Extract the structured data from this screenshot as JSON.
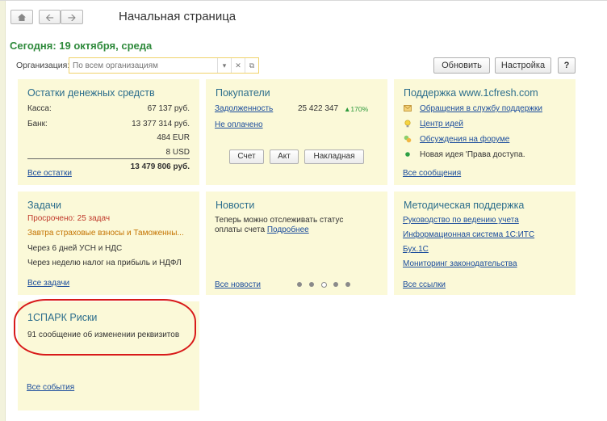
{
  "header": {
    "title": "Начальная страница",
    "home_icon": "home-icon",
    "back_icon": "arrow-left-icon",
    "forward_icon": "arrow-right-icon"
  },
  "today": "Сегодня: 19 октября, среда",
  "organization": {
    "label": "Организация:",
    "placeholder": "По всем организациям"
  },
  "toolbar": {
    "refresh": "Обновить",
    "settings": "Настройка",
    "help": "?"
  },
  "cash": {
    "title": "Остатки денежных средств",
    "rows": [
      {
        "label": "Касса:",
        "value": "67 137 руб."
      },
      {
        "label": "Банк:",
        "value": "13 377 314 руб."
      },
      {
        "label": "",
        "value": "484 EUR"
      },
      {
        "label": "",
        "value": "8 USD"
      }
    ],
    "total": "13 479 806 руб.",
    "link": "Все остатки"
  },
  "buyers": {
    "title": "Покупатели",
    "debt_label": "Задолженность",
    "debt_value": "25 422 347",
    "debt_change": "▲170%",
    "unpaid": "Не оплачено",
    "buttons": [
      "Счет",
      "Акт",
      "Накладная"
    ]
  },
  "support": {
    "title": "Поддержка www.1cfresh.com",
    "items": [
      {
        "icon": "envelope-icon",
        "text": "Обращения в службу поддержки"
      },
      {
        "icon": "lightbulb-icon",
        "text": "Центр идей"
      },
      {
        "icon": "forum-icon",
        "text": "Обсуждения на форуме"
      },
      {
        "icon": "green-dot-icon",
        "text": "Новая идея 'Права доступа."
      }
    ],
    "link": "Все сообщения"
  },
  "tasks": {
    "title": "Задачи",
    "overdue": "Просрочено: 25 задач",
    "items": [
      "Завтра страховые взносы и Таможенны...",
      "Через 6 дней УСН и НДС",
      "Через неделю налог на прибыль и НДФЛ"
    ],
    "link": "Все задачи"
  },
  "news": {
    "title": "Новости",
    "text_line1": "Теперь можно отслеживать статус",
    "text_line2": "оплаты счета",
    "more": "Подробнее",
    "link": "Все новости",
    "pager_active_index": 2
  },
  "methodical": {
    "title": "Методическая поддержка",
    "links": [
      "Руководство по ведению учета",
      "Информационная система 1С:ИТС",
      "Бух.1С",
      "Мониторинг законодательства"
    ],
    "link": "Все ссылки"
  },
  "spark": {
    "title": "1СПАРК Риски",
    "message": "91 сообщение об изменении реквизитов",
    "link": "Все события"
  },
  "colors": {
    "panel_bg": "#fbf9d8",
    "title_blue": "#2b6d8c",
    "link_blue": "#1a4c9c",
    "date_green": "#2f8a3c",
    "overdue_red": "#c0392b",
    "highlight_ring": "#d81a1a"
  }
}
